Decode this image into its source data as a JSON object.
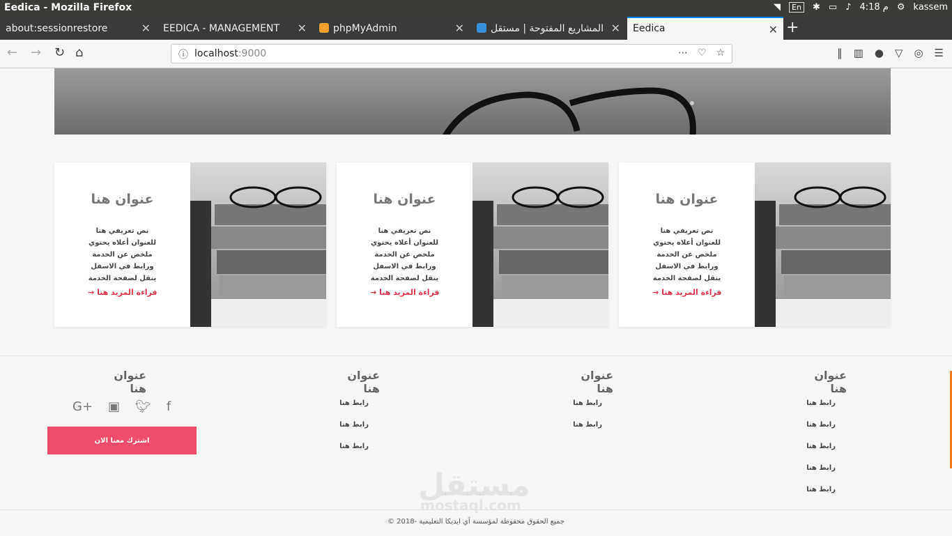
{
  "system": {
    "window_title": "Eedica - Mozilla Firefox",
    "keyboard_layout": "En",
    "time": "4:18 م",
    "user": "kassem"
  },
  "tabs": [
    {
      "label": "about:sessionrestore"
    },
    {
      "label": "EEDICA - MANAGEMENT"
    },
    {
      "label": "phpMyAdmin"
    },
    {
      "label": "المشاريع المفتوحة | مستقل"
    },
    {
      "label": "Eedica"
    }
  ],
  "browser": {
    "url_host": "localhost",
    "url_port": ":9000"
  },
  "cards": [
    {
      "title": "عنوان هنا",
      "description": "نص تعريفي هنا للعنوان أعلاه يحتوي ملخص عن الخدمة ورابط في الاسفل ينقل لصفحة الخدمة",
      "read_more": "قراءة المزيد هنا"
    },
    {
      "title": "عنوان هنا",
      "description": "نص تعريفي هنا للعنوان أعلاه يحتوي ملخص عن الخدمة ورابط في الاسفل ينقل لصفحة الخدمة",
      "read_more": "قراءة المزيد هنا"
    },
    {
      "title": "عنوان هنا",
      "description": "نص تعريفي هنا للعنوان أعلاه يحتوي ملخص عن الخدمة ورابط في الاسفل ينقل لصفحة الخدمة",
      "read_more": "قراءة المزيد هنا"
    }
  ],
  "footer": {
    "columns": [
      {
        "heading": "عنوان هنا",
        "links": [
          "رابط هنا",
          "رابط هنا",
          "رابط هنا",
          "رابط هنا",
          "رابط هنا"
        ]
      },
      {
        "heading": "عنوان هنا",
        "links": [
          "رابط هنا",
          "رابط هنا"
        ]
      },
      {
        "heading": "عنوان هنا",
        "links": [
          "رابط هنا",
          "رابط هنا",
          "رابط هنا"
        ]
      },
      {
        "heading": "عنوان هنا",
        "links": []
      }
    ],
    "subscribe_label": "اشترك معنا الان",
    "copyright": "جميع الحقوق محفوظة لمؤسسة آي ايديكا التعليمية -2018 ©",
    "watermark_ar": "مستقل",
    "watermark_en": "mostaql.com"
  },
  "colors": {
    "accent": "#ef4d6b",
    "link": "#e0334a",
    "firefox_blue": "#0a84ff"
  }
}
